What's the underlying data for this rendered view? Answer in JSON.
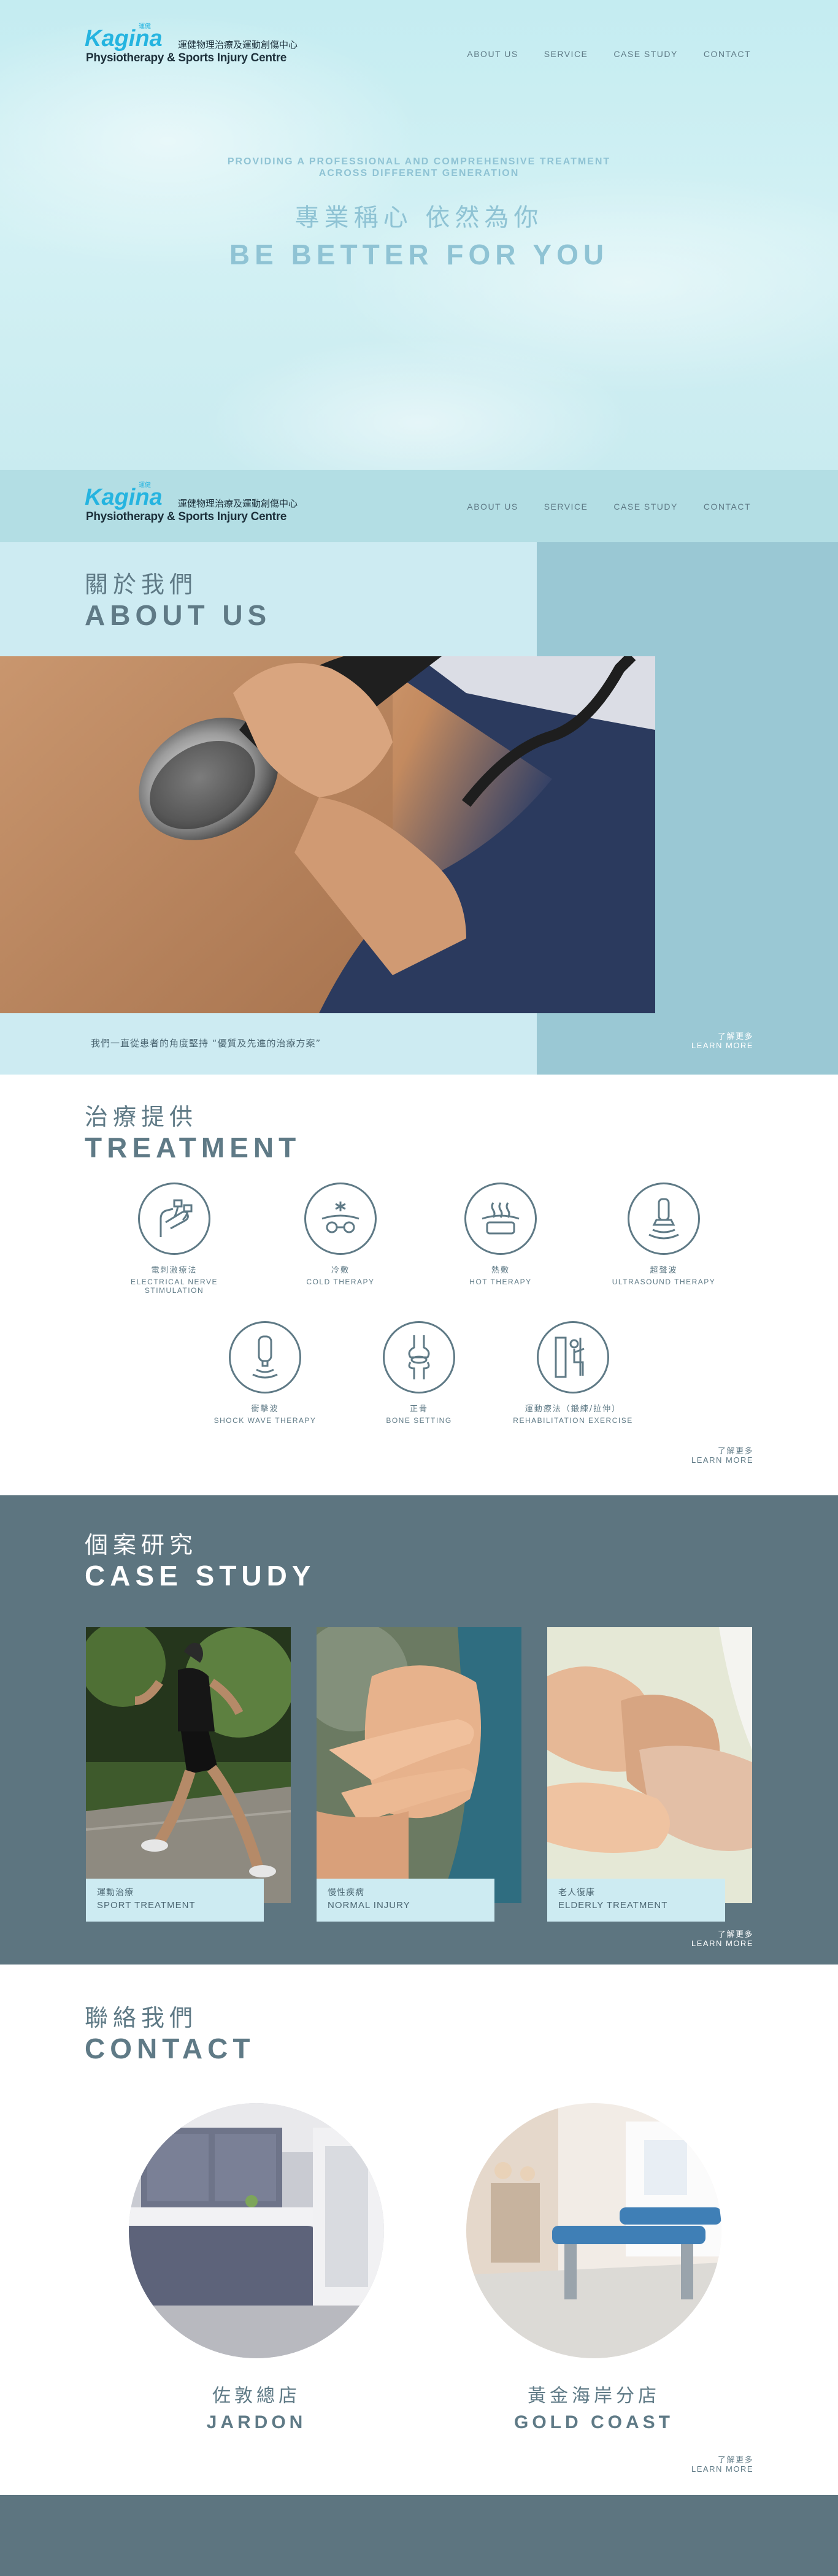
{
  "brand": {
    "name_en": "Kagina",
    "name_zh": "運健物理治療及運動創傷中心",
    "subtitle": "Physiotherapy & Sports Injury Centre",
    "mark": "運健"
  },
  "nav": {
    "items": [
      "ABOUT US",
      "SERVICE",
      "CASE STUDY",
      "CONTACT"
    ]
  },
  "hero": {
    "tagline_1": "PROVIDING A PROFESSIONAL AND COMPREHENSIVE TREATMENT",
    "tagline_2": "ACROSS DIFFERENT GENERATION",
    "slogan_zh": "專業稱心  依然為你",
    "slogan_en": "BE BETTER FOR YOU"
  },
  "about": {
    "title_zh": "關於我們",
    "title_en": "ABOUT US",
    "text": "我們一直從患者的角度堅持 “優質及先進的治療方案”",
    "more_zh": "了解更多",
    "more_en": "LEARN MORE"
  },
  "treatment": {
    "title_zh": "治療提供",
    "title_en": "TREATMENT",
    "items": [
      {
        "zh": "電刺激療法",
        "en": "ELECTRICAL NERVE STIMULATION",
        "icon": "electrical-nerve-stimulation-icon"
      },
      {
        "zh": "冷敷",
        "en": "COLD THERAPY",
        "icon": "cold-therapy-icon"
      },
      {
        "zh": "熱敷",
        "en": "HOT THERAPY",
        "icon": "hot-therapy-icon"
      },
      {
        "zh": "超聲波",
        "en": "ULTRASOUND THERAPY",
        "icon": "ultrasound-therapy-icon"
      },
      {
        "zh": "衝擊波",
        "en": "SHOCK WAVE THERAPY",
        "icon": "shock-wave-therapy-icon"
      },
      {
        "zh": "正骨",
        "en": "BONE SETTING",
        "icon": "bone-setting-icon"
      },
      {
        "zh": "運動療法（鍛練/拉伸）",
        "en": "REHABILITATION EXERCISE",
        "icon": "rehabilitation-exercise-icon"
      }
    ],
    "more_zh": "了解更多",
    "more_en": "LEARN MORE"
  },
  "case_study": {
    "title_zh": "個案研究",
    "title_en": "CASE STUDY",
    "cards": [
      {
        "zh": "運動治療",
        "en": "SPORT TREATMENT"
      },
      {
        "zh": "慢性疾病",
        "en": "NORMAL INJURY"
      },
      {
        "zh": "老人復康",
        "en": "ELDERLY TREATMENT"
      }
    ],
    "more_zh": "了解更多",
    "more_en": "LEARN MORE"
  },
  "contact": {
    "title_zh": "聯絡我們",
    "title_en": "CONTACT",
    "branches": [
      {
        "zh": "佐敦總店",
        "en": "JARDON"
      },
      {
        "zh": "黃金海岸分店",
        "en": "GOLD COAST"
      }
    ],
    "more_zh": "了解更多",
    "more_en": "LEARN MORE"
  },
  "colors": {
    "brand_blue": "#25b4e0",
    "slate": "#5d7580",
    "light_cyan": "#cdebf2",
    "mid_cyan": "#9ac8d4"
  }
}
